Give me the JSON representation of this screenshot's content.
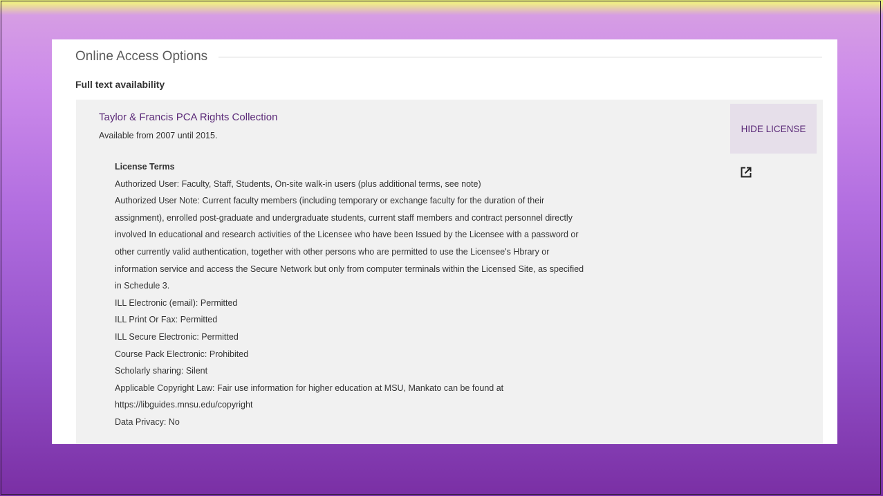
{
  "section": {
    "title": "Online Access Options",
    "subheading": "Full text availability"
  },
  "service": {
    "collection_name": "Taylor & Francis PCA Rights Collection",
    "availability": "Available from 2007 until 2015.",
    "hide_license_label": "HIDE LICENSE",
    "external_link_icon": "external-link-icon"
  },
  "license": {
    "heading": "License Terms",
    "authorized_user": "Authorized User: Faculty, Staff, Students, On-site walk-in users (plus additional terms, see note)",
    "authorized_user_note_lines": [
      "Authorized User Note: Current faculty members (including temporary or exchange faculty for the duration of their",
      "assignment), enrolled post-graduate and undergraduate students, current staff members and contract personnel directly",
      "involved In educational and research activities of the Licensee who have been Issued by the Licensee with a password or",
      "other currently valid authentication, together with other persons who are permitted to use the Licensee's Hbrary or",
      "information service and access the Secure Network but only from computer terminals within the Licensed Site, as specified",
      "in Schedule 3."
    ],
    "ill_electronic": "ILL Electronic (email): Permitted",
    "ill_print_fax": "ILL Print Or Fax: Permitted",
    "ill_secure_electronic": "ILL Secure Electronic: Permitted",
    "course_pack_electronic": "Course Pack Electronic: Prohibited",
    "scholarly_sharing": "Scholarly sharing: Silent",
    "copyright_law_lines": [
      "Applicable Copyright Law: Fair use information for higher education at MSU, Mankato can be found at",
      "https://libguides.mnsu.edu/copyright"
    ],
    "data_privacy": "Data Privacy: No"
  }
}
